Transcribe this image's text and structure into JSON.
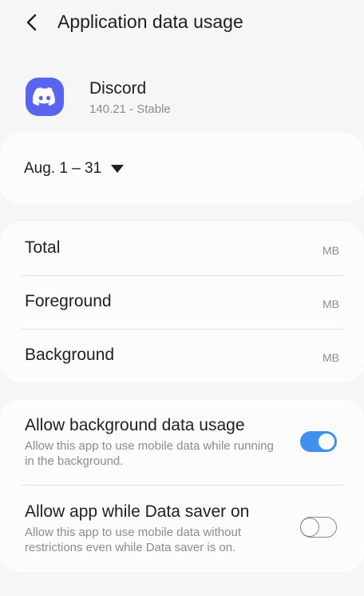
{
  "header": {
    "title": "Application data usage",
    "back_icon": "back-chevron-icon"
  },
  "app": {
    "name": "Discord",
    "version": "140.21 - Stable",
    "icon": "discord-logo-icon",
    "icon_color": "#5865f2"
  },
  "date_range": {
    "label": "Aug. 1 – 31",
    "icon": "dropdown-arrow-icon"
  },
  "usage": {
    "rows": [
      {
        "label": "Total",
        "unit": "MB"
      },
      {
        "label": "Foreground",
        "unit": "MB"
      },
      {
        "label": "Background",
        "unit": "MB"
      }
    ]
  },
  "settings": {
    "items": [
      {
        "title": "Allow background data usage",
        "description": "Allow this app to use mobile data while running in the background.",
        "enabled": true
      },
      {
        "title": "Allow app while Data saver on",
        "description": "Allow this app to use mobile data without restrictions even while Data saver is on.",
        "enabled": false
      }
    ]
  },
  "colors": {
    "accent": "#3e91ec",
    "background": "#f6f6f6",
    "card": "#fcfcfc",
    "secondary_text": "#8c8c8c"
  }
}
